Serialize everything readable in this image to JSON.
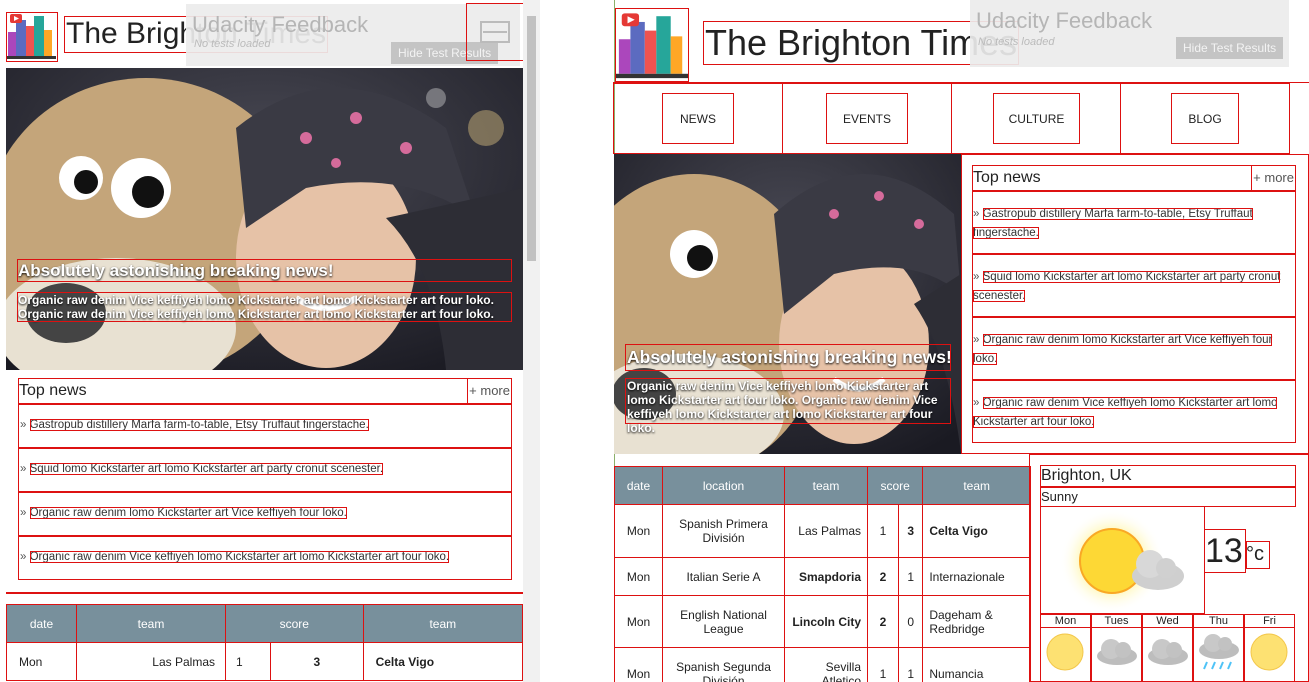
{
  "site": {
    "title": "The Brighton Times"
  },
  "feedback": {
    "title": "Udacity Feedback",
    "status": "No tests loaded",
    "button": "Hide Test Results"
  },
  "nav": [
    "NEWS",
    "EVENTS",
    "CULTURE",
    "BLOG"
  ],
  "hero": {
    "headline": "Absolutely astonishing breaking news!",
    "blurb": "Organic raw denim Vice keffiyeh lomo Kickstarter art lomo Kickstarter art four loko. Organic raw denim Vice keffiyeh lomo Kickstarter art lomo Kickstarter art four loko."
  },
  "topnews": {
    "title": "Top news",
    "more": "+ more",
    "items": [
      "Gastropub distillery Marfa farm-to-table, Etsy Truffaut fingerstache.",
      "Squid lomo Kickstarter art lomo Kickstarter art party cronut scenester.",
      "Organic raw denim lomo Kickstarter art Vice keffiyeh four loko.",
      "Organic raw denim Vice keffiyeh lomo Kickstarter art lomo Kickstarter art four loko."
    ]
  },
  "scores_small": {
    "headers": [
      "date",
      "team",
      "score",
      "team"
    ],
    "rows": [
      [
        "Mon",
        "Las Palmas",
        "1",
        "3",
        "Celta Vigo"
      ]
    ]
  },
  "scores": {
    "headers": [
      "date",
      "location",
      "team",
      "score",
      "team"
    ],
    "rows": [
      [
        "Mon",
        "Spanish Primera División",
        "Las Palmas",
        "1",
        "3",
        "Celta Vigo"
      ],
      [
        "Mon",
        "Italian Serie A",
        "Smapdoria",
        "2",
        "1",
        "Internazionale"
      ],
      [
        "Mon",
        "English National League",
        "Lincoln City",
        "2",
        "0",
        "Dageham & Redbridge"
      ],
      [
        "Mon",
        "Spanish Segunda División",
        "Sevilla Atletico",
        "1",
        "1",
        "Numancia"
      ]
    ]
  },
  "weather": {
    "city": "Brighton, UK",
    "condition": "Sunny",
    "temp": "13",
    "unit": "°c",
    "days": [
      "Mon",
      "Tues",
      "Wed",
      "Thu",
      "Fri"
    ],
    "icons": [
      "sun-icon",
      "cloud-icon",
      "cloud-icon",
      "rain-icon",
      "sun-icon"
    ]
  },
  "colors": {
    "accent": "#dd1111",
    "table_header": "#78909c"
  }
}
